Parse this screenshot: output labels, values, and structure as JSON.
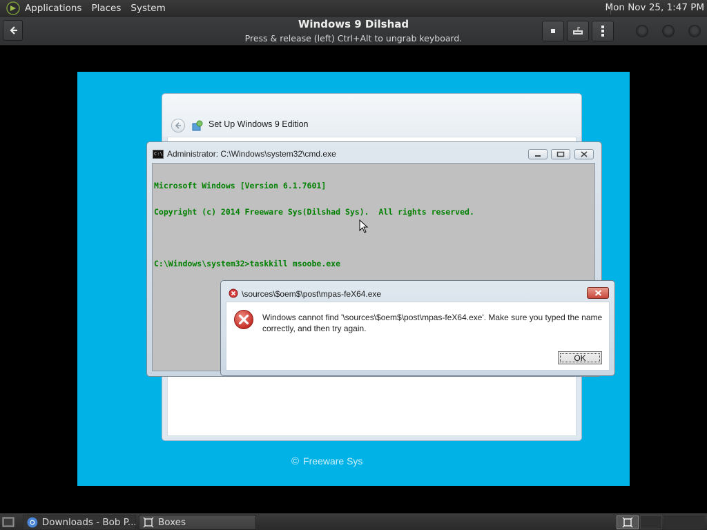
{
  "top_panel": {
    "menus": [
      "Applications",
      "Places",
      "System"
    ],
    "clock": "Mon Nov 25, 1:47 PM"
  },
  "header": {
    "title": "Windows 9 Dilshad",
    "subtitle": "Press & release (left) Ctrl+Alt to ungrab keyboard."
  },
  "guest": {
    "background_color": "#00b2e6",
    "setup_window": {
      "title": "Set Up Windows 9 Edition"
    },
    "footer_brand": "Freeware Sys",
    "cmd_window": {
      "title": "Administrator: C:\\Windows\\system32\\cmd.exe",
      "lines": [
        "Microsoft Windows [Version 6.1.7601]",
        "Copyright (c) 2014 Freeware Sys(Dilshad Sys).  All rights reserved.",
        "",
        "C:\\Windows\\system32>taskkill msoobe.exe"
      ],
      "text_color": "#008000"
    },
    "error_dialog": {
      "title": "\\sources\\$oem$\\post\\mpas-feX64.exe",
      "message": "Windows cannot find '\\sources\\$oem$\\post\\mpas-feX64.exe'. Make sure you typed the name correctly, and then try again.",
      "ok_label": "OK"
    }
  },
  "taskbar": {
    "tasks": [
      {
        "label": "Downloads - Bob P...",
        "icon": "chrome-icon"
      },
      {
        "label": "Boxes",
        "icon": "boxes-icon"
      }
    ]
  }
}
